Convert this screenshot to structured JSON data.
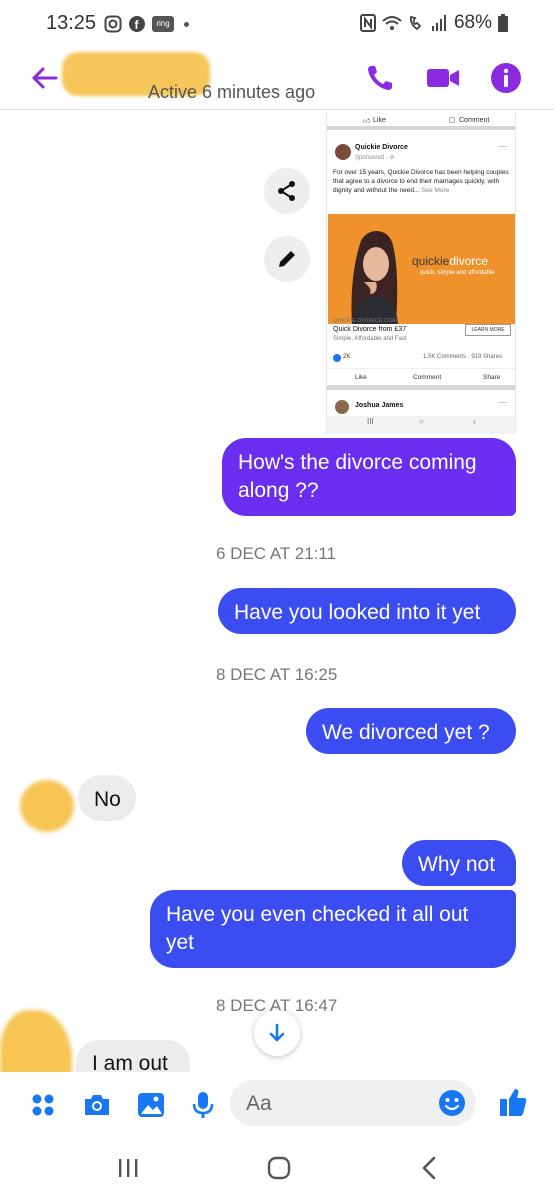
{
  "status_bar": {
    "time": "13:25",
    "app_icon_label": "ring",
    "battery": "68%"
  },
  "header": {
    "active_status": "Active 6 minutes ago"
  },
  "shared_post": {
    "top_like": "Like",
    "top_comment": "Comment",
    "page_name": "Quickie Divorce",
    "sponsored": "Sponsored · ⊘",
    "body": "For over 15 years, Quickie Divorce has been helping couples that agree to a divorce to end their marriages quickly, with dignity and without the need...",
    "see_more": "See More",
    "brand_part1": "quickie",
    "brand_part2": "divorce",
    "brand_tagline": "quick, simple and affordable",
    "domain": "QUICKIE-DIVORCE.COM",
    "headline": "Quick Divorce from £37",
    "subline": "Simple, Affordable and Fast",
    "learn_more": "LEARN MORE",
    "reactions": "2K",
    "counts": "1.5K Comments · 919 Shares",
    "like": "Like",
    "comment": "Comment",
    "share": "Share",
    "next_author": "Joshua James",
    "more": "···"
  },
  "messages": [
    {
      "text": "How's the divorce coming along ??"
    },
    {
      "timestamp": "6 DEC AT 21:11"
    },
    {
      "text": "Have you looked into it yet"
    },
    {
      "timestamp": "8 DEC AT 16:25"
    },
    {
      "text": "We divorced yet ?"
    },
    {
      "text": "No"
    },
    {
      "text": "Why not"
    },
    {
      "text": "Have you even checked it all out yet"
    },
    {
      "timestamp": "8 DEC AT 16:47"
    },
    {
      "text": "I am out"
    }
  ],
  "composer": {
    "placeholder": "Aa"
  },
  "colors": {
    "accent_purple": "#6a2ef0",
    "accent_blue": "#3b4df0",
    "header_icons": "#8a2be2",
    "composer_icons": "#1877f2",
    "ad_orange": "#ef922b"
  }
}
